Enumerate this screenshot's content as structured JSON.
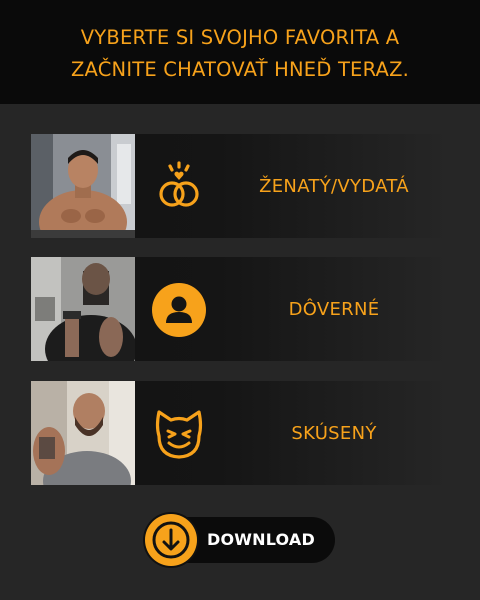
{
  "header": {
    "line1": "VYBERTE SI SVOJHO FAVORITA A",
    "line2": "ZAČNITE CHATOVAŤ HNEĎ TERAZ."
  },
  "cards": [
    {
      "label": "ŽENATÝ/VYDATÁ",
      "icon": "wedding-rings-icon"
    },
    {
      "label": "DÔVERNÉ",
      "icon": "person-icon"
    },
    {
      "label": "SKÚSENÝ",
      "icon": "devil-face-icon"
    }
  ],
  "download": {
    "label": "DOWNLOAD",
    "icon": "arrow-down-icon"
  },
  "colors": {
    "accent": "#f7a21b",
    "background": "#262626",
    "header_bg": "#0a0a0a"
  }
}
